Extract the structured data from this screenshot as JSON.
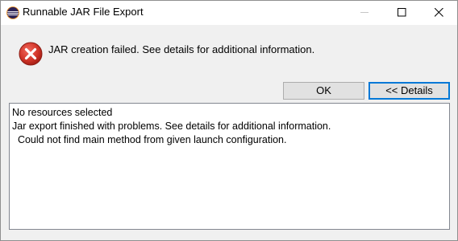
{
  "window": {
    "title": "Runnable JAR File Export",
    "icon": "eclipse-icon",
    "controls": {
      "minimize_icon": "minimize-icon",
      "maximize_icon": "maximize-icon",
      "close_icon": "close-icon"
    }
  },
  "dialog": {
    "icon": "error-icon",
    "icon_color": "#c42b1c",
    "message": "JAR creation failed. See details for additional information."
  },
  "buttons": {
    "ok_label": "OK",
    "details_label": "<< Details"
  },
  "details": {
    "lines": [
      "No resources selected",
      "Jar export finished with problems. See details for additional information.",
      "  Could not find main method from given launch configuration."
    ]
  },
  "colors": {
    "focus_border": "#0078d7",
    "dialog_background": "#f0f0f0"
  }
}
